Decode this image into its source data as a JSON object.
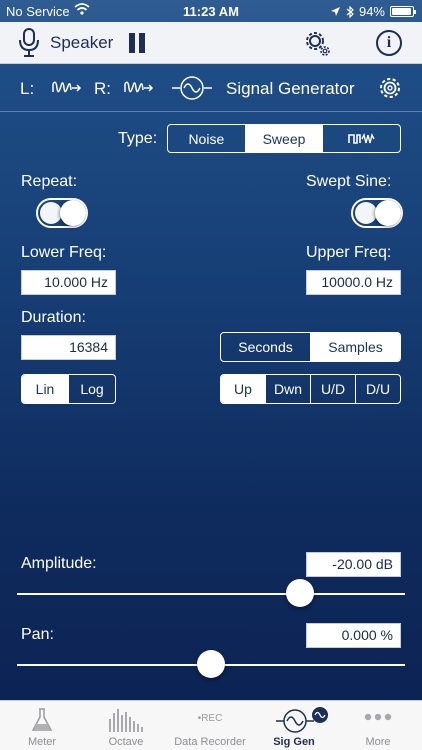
{
  "status": {
    "carrier": "No Service",
    "time": "11:23 AM",
    "battery": "94%",
    "battery_level": 0.94
  },
  "toolbar": {
    "title": "Speaker"
  },
  "generator": {
    "left_label": "L:",
    "right_label": "R:",
    "title": "Signal Generator"
  },
  "type": {
    "label": "Type:",
    "options": [
      "Noise",
      "Sweep"
    ],
    "selected": "Sweep"
  },
  "repeat": {
    "label": "Repeat:",
    "on": true
  },
  "swept_sine": {
    "label": "Swept Sine:",
    "on": true
  },
  "lower_freq": {
    "label": "Lower Freq:",
    "value": "10.000 Hz"
  },
  "upper_freq": {
    "label": "Upper Freq:",
    "value": "10000.0 Hz"
  },
  "duration": {
    "label": "Duration:",
    "value": "16384",
    "units": [
      "Seconds",
      "Samples"
    ],
    "selected_unit": "Samples"
  },
  "scale": {
    "options": [
      "Lin",
      "Log"
    ],
    "selected": "Lin"
  },
  "direction": {
    "options": [
      "Up",
      "Dwn",
      "U/D",
      "D/U"
    ],
    "selected": "Up"
  },
  "amplitude": {
    "label": "Amplitude:",
    "value": "-20.00 dB",
    "slider_fraction": 0.73
  },
  "pan": {
    "label": "Pan:",
    "value": "0.000 %",
    "slider_fraction": 0.5
  },
  "tabs": [
    {
      "label": "Meter",
      "icon": "flask-icon"
    },
    {
      "label": "Octave",
      "icon": "bars-icon"
    },
    {
      "label": "Data Recorder",
      "icon": "rec-icon",
      "rec_text": "•REC"
    },
    {
      "label": "Sig Gen",
      "icon": "sine-wave-icon",
      "active": true
    },
    {
      "label": "More",
      "icon": "more-dots-icon"
    }
  ],
  "colors": {
    "accent": "#1d2f55",
    "panel_top": "#1f4d86",
    "panel_bottom": "#0c2454"
  }
}
